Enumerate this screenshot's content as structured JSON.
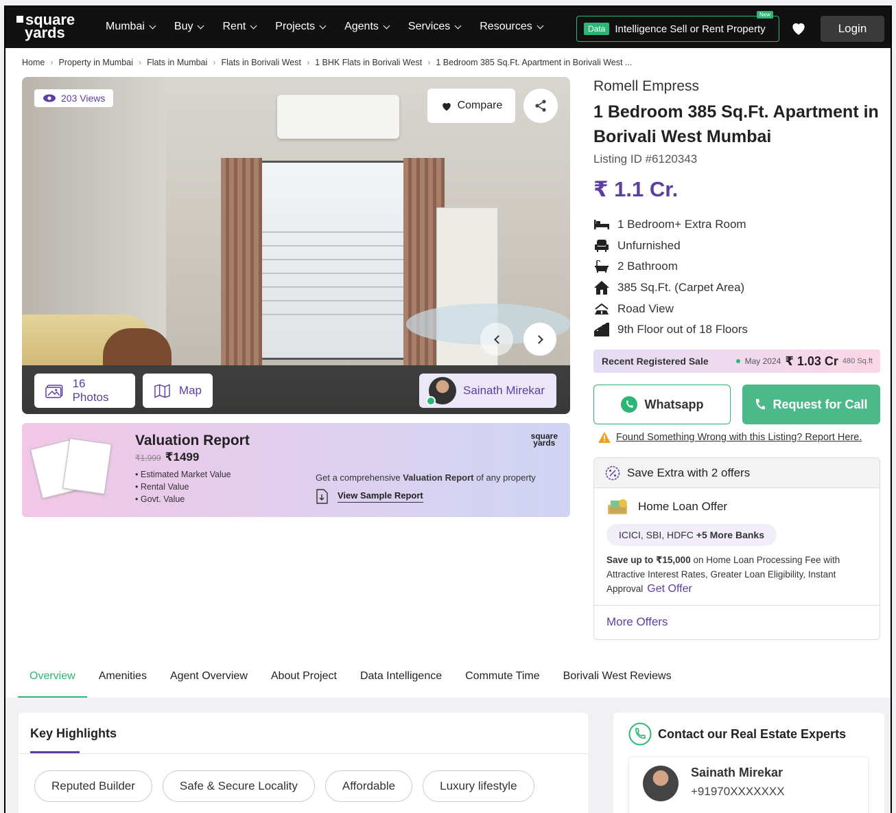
{
  "header": {
    "logo_line1": "square",
    "logo_line2": "yards",
    "nav": [
      {
        "label": "Mumbai"
      },
      {
        "label": "Buy"
      },
      {
        "label": "Rent"
      },
      {
        "label": "Projects"
      },
      {
        "label": "Agents"
      },
      {
        "label": "Services"
      },
      {
        "label": "Resources"
      }
    ],
    "data_badge": "Data",
    "data_intel_text": "Intelligence Sell or Rent Property",
    "new_badge": "New",
    "login_label": "Login"
  },
  "breadcrumb": [
    "Home",
    "Property in Mumbai",
    "Flats in Mumbai",
    "Flats in Borivali West",
    "1 BHK Flats in Borivali West",
    "1 Bedroom 385 Sq.Ft. Apartment in Borivali West ..."
  ],
  "gallery": {
    "views": "203 Views",
    "compare_label": "Compare",
    "photos_label": "16 Photos",
    "map_label": "Map",
    "agent_name": "Sainath Mirekar"
  },
  "valuation": {
    "title": "Valuation Report",
    "old_price": "₹1,999",
    "price": "₹1499",
    "items": [
      "Estimated Market Value",
      "Rental Value",
      "Govt. Value"
    ],
    "logo_line1": "square",
    "logo_line2": "yards",
    "desc_pre": "Get a comprehensive ",
    "desc_bold": "Valuation Report",
    "desc_post": " of any property",
    "sample_label": "View Sample Report"
  },
  "property": {
    "project_name": "Romell Empress",
    "title": "1 Bedroom 385 Sq.Ft. Apartment in Borivali West Mumbai",
    "listing_id": "Listing ID #6120343",
    "price": "₹ 1.1 Cr.",
    "features": [
      {
        "icon": "bed-icon",
        "text": "1 Bedroom+ Extra Room"
      },
      {
        "icon": "armchair-icon",
        "text": "Unfurnished"
      },
      {
        "icon": "bathtub-icon",
        "text": "2 Bathroom"
      },
      {
        "icon": "home-icon",
        "text": "385 Sq.Ft. (Carpet Area)"
      },
      {
        "icon": "road-view-icon",
        "text": "Road View"
      },
      {
        "icon": "building-floor-icon",
        "text": "9th Floor out of 18 Floors"
      }
    ]
  },
  "recent_sale": {
    "label": "Recent Registered Sale",
    "date": "May 2024",
    "amount": "₹ 1.03 Cr",
    "area": "480 Sq.ft"
  },
  "actions": {
    "whatsapp_label": "Whatsapp",
    "call_label": "Request for Call",
    "report_text": "Found Something Wrong with this Listing? Report Here."
  },
  "offers": {
    "heading": "Save Extra with 2 offers",
    "home_loan_title": "Home Loan Offer",
    "banks": "ICICI, SBI, HDFC",
    "banks_more": "+5 More Banks",
    "desc_bold": "Save up to ₹15,000",
    "desc": " on Home Loan Processing Fee with Attractive Interest Rates, Greater Loan Eligibility, Instant Approval",
    "get_offer": "Get Offer",
    "more_offers": "More Offers"
  },
  "tabs": [
    "Overview",
    "Amenities",
    "Agent Overview",
    "About Project",
    "Data Intelligence",
    "Commute Time",
    "Borivali West Reviews"
  ],
  "key_highlights": {
    "title": "Key Highlights",
    "chips": [
      "Reputed Builder",
      "Safe & Secure Locality",
      "Affordable",
      "Luxury lifestyle"
    ]
  },
  "contact": {
    "title": "Contact our Real Estate Experts",
    "agent_name": "Sainath Mirekar",
    "agent_phone": "+91970XXXXXXX"
  },
  "colors": {
    "brand_purple": "#5b3fa0",
    "green": "#2bb673",
    "header_bg": "#111111"
  }
}
